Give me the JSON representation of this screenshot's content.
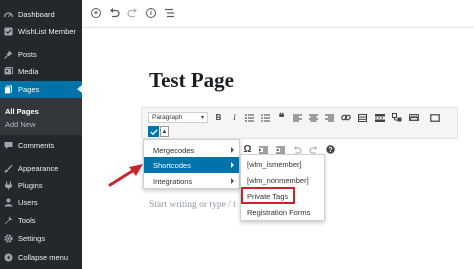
{
  "sidebar": {
    "items": [
      {
        "label": "Dashboard",
        "icon": "dashboard-icon"
      },
      {
        "label": "WishList Member",
        "icon": "wishlist-icon"
      },
      {
        "label": "Posts",
        "icon": "pin-icon"
      },
      {
        "label": "Media",
        "icon": "media-icon"
      },
      {
        "label": "Pages",
        "icon": "pages-icon"
      },
      {
        "label": "Comments",
        "icon": "comments-icon"
      },
      {
        "label": "Appearance",
        "icon": "appearance-icon"
      },
      {
        "label": "Plugins",
        "icon": "plugins-icon"
      },
      {
        "label": "Users",
        "icon": "users-icon"
      },
      {
        "label": "Tools",
        "icon": "tools-icon"
      },
      {
        "label": "Settings",
        "icon": "settings-icon"
      },
      {
        "label": "Collapse menu",
        "icon": "collapse-icon"
      }
    ],
    "subitems": [
      {
        "label": "All Pages"
      },
      {
        "label": "Add New"
      }
    ],
    "active_color": "#0073aa"
  },
  "editor": {
    "title": "Test Page",
    "format_select": "Paragraph",
    "placeholder": "Start writing or type / t"
  },
  "shortcode_menu": {
    "items": [
      {
        "label": "Mergecodes"
      },
      {
        "label": "Shortcodes"
      },
      {
        "label": "Integrations"
      }
    ],
    "submenu": [
      {
        "label": "[wlm_ismember]"
      },
      {
        "label": "[wlm_nonmember]"
      },
      {
        "label": "Private Tags"
      },
      {
        "label": "Registration Forms"
      }
    ]
  },
  "colors": {
    "highlight_red": "#c9262c",
    "sidebar_bg": "#23282d"
  }
}
